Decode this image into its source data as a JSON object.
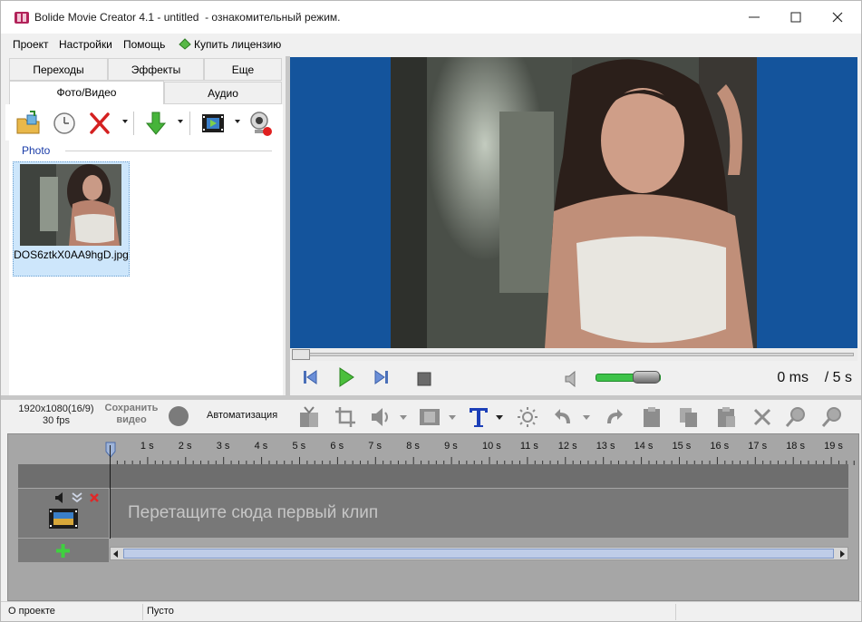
{
  "window": {
    "title": "Bolide Movie Creator 4.1 - untitled  - ознакомительный режим.",
    "minimize_icon": "minimize-icon",
    "maximize_icon": "maximize-icon",
    "close_icon": "close-icon"
  },
  "menu": {
    "items": [
      "Проект",
      "Настройки",
      "Помощь"
    ],
    "license": "Купить лицензию"
  },
  "tabs": {
    "row1": [
      "Переходы",
      "Эффекты",
      "Еще"
    ],
    "row2": [
      "Фото/Видео",
      "Аудио"
    ],
    "active": "Фото/Видео"
  },
  "media": {
    "group": "Photo",
    "file_name": "DOS6ztkX0AA9hgD.jpg"
  },
  "player": {
    "time_current": "0 ms",
    "time_total": "/ 5 s",
    "volume_fraction": 0.85,
    "position_fraction": 0.0
  },
  "timeline_toolbar": {
    "resolution": "1920x1080(16/9)",
    "fps": "30 fps",
    "save_video": "Сохранить видео",
    "automation": "Автоматизация"
  },
  "timeline": {
    "ruler": [
      "1 s",
      "2 s",
      "3 s",
      "4 s",
      "5 s",
      "6 s",
      "7 s",
      "8 s",
      "9 s",
      "10 s",
      "11 s",
      "12 s",
      "13 s",
      "14 s",
      "15 s",
      "16 s",
      "17 s",
      "18 s",
      "19 s"
    ],
    "drop_hint": "Перетащите сюда первый клип"
  },
  "status": {
    "about": "О проекте",
    "state": "Пусто"
  },
  "colors": {
    "preview_bg": "#14549c",
    "accent_blue": "#1a3ca8",
    "volume_green": "#3ec34a"
  }
}
